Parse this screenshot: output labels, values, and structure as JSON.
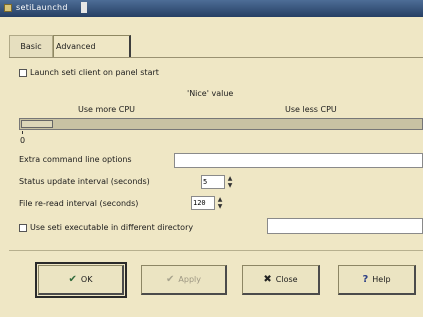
{
  "window": {
    "title": "setiLaunchd"
  },
  "tabs": [
    {
      "label": "Basic"
    },
    {
      "label": "Advanced"
    }
  ],
  "advanced": {
    "launch_on_start_label": "Launch seti client on panel start",
    "nice_label": "'Nice' value",
    "more_cpu_label": "Use more CPU",
    "less_cpu_label": "Use less CPU",
    "nice_value": 0,
    "nice_tick": "0",
    "extra_options_label": "Extra command line options",
    "extra_options_value": "",
    "status_interval_label": "Status update interval (seconds)",
    "status_interval_value": "5",
    "file_reread_label": "File re-read interval (seconds)",
    "file_reread_value": "120",
    "use_exec_label": "Use seti executable in different directory",
    "use_exec_value": ""
  },
  "buttons": {
    "ok": "OK",
    "apply": "Apply",
    "close": "Close",
    "help": "Help"
  },
  "icons": {
    "ok": "checkmark-icon",
    "apply": "checkmark-icon",
    "close": "close-x-icon",
    "help": "question-icon"
  },
  "colors": {
    "background": "#efe7c5",
    "titlebar": "#2e4a73"
  }
}
